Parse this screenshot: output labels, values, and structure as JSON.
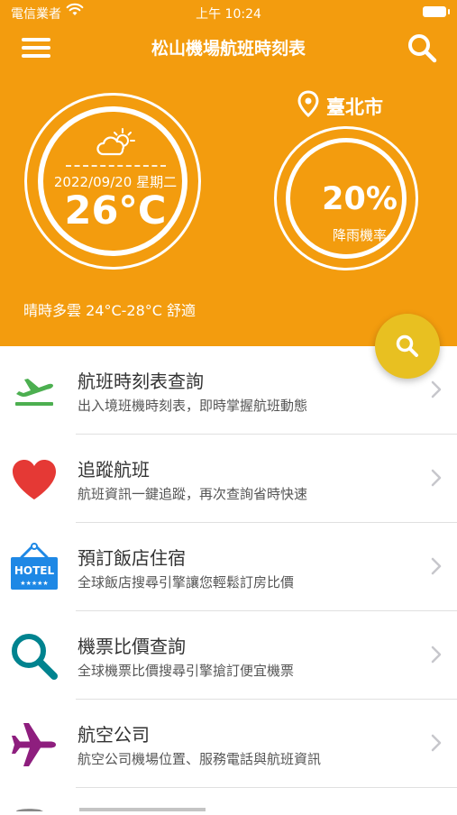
{
  "status_bar": {
    "carrier": "電信業者",
    "time": "上午 10:24"
  },
  "nav": {
    "title": "松山機場航班時刻表",
    "menu_icon": "hamburger-menu-icon",
    "search_icon": "search-icon"
  },
  "weather": {
    "icon": "partly-cloudy-icon",
    "date": "2022/09/20 星期二",
    "temperature": "26°C",
    "summary": "晴時多雲 24°C-28°C 舒適"
  },
  "location": {
    "icon": "map-pin-icon",
    "city": "臺北市"
  },
  "rain": {
    "percent": "20%",
    "label": "降雨機率"
  },
  "fab": {
    "icon": "search-icon"
  },
  "colors": {
    "header_bg": "#F39C0E",
    "fab_bg": "#E8C021",
    "flight_icon": "#4CAF50",
    "heart_icon": "#E53935",
    "hotel_icon": "#1E88E5",
    "search_icon": "#00838F",
    "plane_icon": "#8E1E7E"
  },
  "menu": [
    {
      "icon": "flight-departure-icon",
      "title": "航班時刻表查詢",
      "subtitle": "出入境班機時刻表，即時掌握航班動態"
    },
    {
      "icon": "heart-icon",
      "title": "追蹤航班",
      "subtitle": "航班資訊一鍵追蹤，再次查詢省時快速"
    },
    {
      "icon": "hotel-sign-icon",
      "hotel_label": "HOTEL",
      "hotel_stars": "★★★★★",
      "title": "預訂飯店住宿",
      "subtitle": "全球飯店搜尋引擎讓您輕鬆訂房比價"
    },
    {
      "icon": "magnifier-icon",
      "title": "機票比價查詢",
      "subtitle": "全球機票比價搜尋引擎搶訂便宜機票"
    },
    {
      "icon": "airplane-icon",
      "title": "航空公司",
      "subtitle": "航空公司機場位置、服務電話與航班資訊"
    }
  ]
}
